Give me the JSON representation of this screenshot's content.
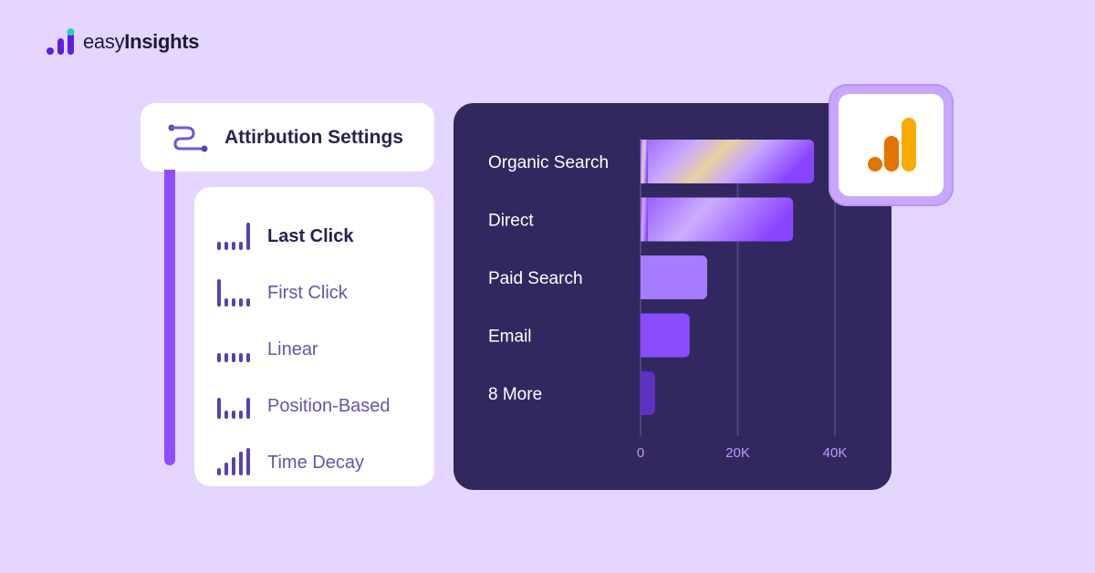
{
  "brand": {
    "name_prefix": "easy",
    "name_suffix": "Insights",
    "accent": "#5b1ee6",
    "accent_dot": "#27d4a8"
  },
  "settings": {
    "title": "Attirbution Settings",
    "icon": "route-icon"
  },
  "models": [
    {
      "label": "Last Click",
      "icon": "last-click-bars-icon",
      "active": true
    },
    {
      "label": "First Click",
      "icon": "first-click-bars-icon",
      "active": false
    },
    {
      "label": "Linear",
      "icon": "linear-bars-icon",
      "active": false
    },
    {
      "label": "Position-Based",
      "icon": "position-based-bars-icon",
      "active": false
    },
    {
      "label": "Time Decay",
      "icon": "time-decay-bars-icon",
      "active": false
    }
  ],
  "colors": {
    "background": "#e4d6ff",
    "chart_bg": "#32285f",
    "bar_light": "#a77bff",
    "bar_mid": "#8a4bff",
    "bar_dark": "#5f30c4",
    "gridline": "#4d4384",
    "axis_tick": "#b79cff",
    "ga_orange": "#e37400",
    "ga_yellow": "#f9ab00"
  },
  "chart_data": {
    "type": "bar",
    "orientation": "horizontal",
    "title": "",
    "xlabel": "",
    "ylabel": "",
    "categories": [
      "Organic Search",
      "Direct",
      "Paid Search",
      "Email",
      "8 More"
    ],
    "values": [
      35700,
      31400,
      13700,
      10100,
      3000
    ],
    "xlim": [
      0,
      40000
    ],
    "xticks": [
      0,
      20000,
      40000
    ],
    "xtick_labels": [
      "0",
      "20K",
      "40K"
    ],
    "grid": true,
    "legend": "none"
  },
  "badge": {
    "icon": "google-analytics-icon"
  }
}
